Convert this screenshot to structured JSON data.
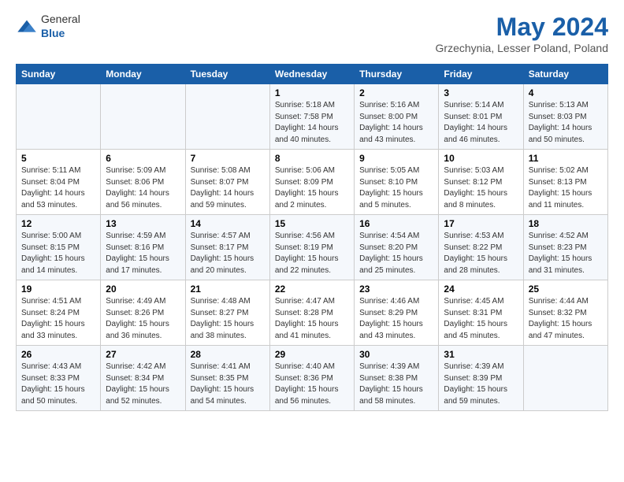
{
  "logo": {
    "text_general": "General",
    "text_blue": "Blue"
  },
  "header": {
    "month": "May 2024",
    "location": "Grzechynia, Lesser Poland, Poland"
  },
  "weekdays": [
    "Sunday",
    "Monday",
    "Tuesday",
    "Wednesday",
    "Thursday",
    "Friday",
    "Saturday"
  ],
  "weeks": [
    [
      {
        "day": "",
        "sunrise": "",
        "sunset": "",
        "daylight": ""
      },
      {
        "day": "",
        "sunrise": "",
        "sunset": "",
        "daylight": ""
      },
      {
        "day": "",
        "sunrise": "",
        "sunset": "",
        "daylight": ""
      },
      {
        "day": "1",
        "sunrise": "Sunrise: 5:18 AM",
        "sunset": "Sunset: 7:58 PM",
        "daylight": "Daylight: 14 hours and 40 minutes."
      },
      {
        "day": "2",
        "sunrise": "Sunrise: 5:16 AM",
        "sunset": "Sunset: 8:00 PM",
        "daylight": "Daylight: 14 hours and 43 minutes."
      },
      {
        "day": "3",
        "sunrise": "Sunrise: 5:14 AM",
        "sunset": "Sunset: 8:01 PM",
        "daylight": "Daylight: 14 hours and 46 minutes."
      },
      {
        "day": "4",
        "sunrise": "Sunrise: 5:13 AM",
        "sunset": "Sunset: 8:03 PM",
        "daylight": "Daylight: 14 hours and 50 minutes."
      }
    ],
    [
      {
        "day": "5",
        "sunrise": "Sunrise: 5:11 AM",
        "sunset": "Sunset: 8:04 PM",
        "daylight": "Daylight: 14 hours and 53 minutes."
      },
      {
        "day": "6",
        "sunrise": "Sunrise: 5:09 AM",
        "sunset": "Sunset: 8:06 PM",
        "daylight": "Daylight: 14 hours and 56 minutes."
      },
      {
        "day": "7",
        "sunrise": "Sunrise: 5:08 AM",
        "sunset": "Sunset: 8:07 PM",
        "daylight": "Daylight: 14 hours and 59 minutes."
      },
      {
        "day": "8",
        "sunrise": "Sunrise: 5:06 AM",
        "sunset": "Sunset: 8:09 PM",
        "daylight": "Daylight: 15 hours and 2 minutes."
      },
      {
        "day": "9",
        "sunrise": "Sunrise: 5:05 AM",
        "sunset": "Sunset: 8:10 PM",
        "daylight": "Daylight: 15 hours and 5 minutes."
      },
      {
        "day": "10",
        "sunrise": "Sunrise: 5:03 AM",
        "sunset": "Sunset: 8:12 PM",
        "daylight": "Daylight: 15 hours and 8 minutes."
      },
      {
        "day": "11",
        "sunrise": "Sunrise: 5:02 AM",
        "sunset": "Sunset: 8:13 PM",
        "daylight": "Daylight: 15 hours and 11 minutes."
      }
    ],
    [
      {
        "day": "12",
        "sunrise": "Sunrise: 5:00 AM",
        "sunset": "Sunset: 8:15 PM",
        "daylight": "Daylight: 15 hours and 14 minutes."
      },
      {
        "day": "13",
        "sunrise": "Sunrise: 4:59 AM",
        "sunset": "Sunset: 8:16 PM",
        "daylight": "Daylight: 15 hours and 17 minutes."
      },
      {
        "day": "14",
        "sunrise": "Sunrise: 4:57 AM",
        "sunset": "Sunset: 8:17 PM",
        "daylight": "Daylight: 15 hours and 20 minutes."
      },
      {
        "day": "15",
        "sunrise": "Sunrise: 4:56 AM",
        "sunset": "Sunset: 8:19 PM",
        "daylight": "Daylight: 15 hours and 22 minutes."
      },
      {
        "day": "16",
        "sunrise": "Sunrise: 4:54 AM",
        "sunset": "Sunset: 8:20 PM",
        "daylight": "Daylight: 15 hours and 25 minutes."
      },
      {
        "day": "17",
        "sunrise": "Sunrise: 4:53 AM",
        "sunset": "Sunset: 8:22 PM",
        "daylight": "Daylight: 15 hours and 28 minutes."
      },
      {
        "day": "18",
        "sunrise": "Sunrise: 4:52 AM",
        "sunset": "Sunset: 8:23 PM",
        "daylight": "Daylight: 15 hours and 31 minutes."
      }
    ],
    [
      {
        "day": "19",
        "sunrise": "Sunrise: 4:51 AM",
        "sunset": "Sunset: 8:24 PM",
        "daylight": "Daylight: 15 hours and 33 minutes."
      },
      {
        "day": "20",
        "sunrise": "Sunrise: 4:49 AM",
        "sunset": "Sunset: 8:26 PM",
        "daylight": "Daylight: 15 hours and 36 minutes."
      },
      {
        "day": "21",
        "sunrise": "Sunrise: 4:48 AM",
        "sunset": "Sunset: 8:27 PM",
        "daylight": "Daylight: 15 hours and 38 minutes."
      },
      {
        "day": "22",
        "sunrise": "Sunrise: 4:47 AM",
        "sunset": "Sunset: 8:28 PM",
        "daylight": "Daylight: 15 hours and 41 minutes."
      },
      {
        "day": "23",
        "sunrise": "Sunrise: 4:46 AM",
        "sunset": "Sunset: 8:29 PM",
        "daylight": "Daylight: 15 hours and 43 minutes."
      },
      {
        "day": "24",
        "sunrise": "Sunrise: 4:45 AM",
        "sunset": "Sunset: 8:31 PM",
        "daylight": "Daylight: 15 hours and 45 minutes."
      },
      {
        "day": "25",
        "sunrise": "Sunrise: 4:44 AM",
        "sunset": "Sunset: 8:32 PM",
        "daylight": "Daylight: 15 hours and 47 minutes."
      }
    ],
    [
      {
        "day": "26",
        "sunrise": "Sunrise: 4:43 AM",
        "sunset": "Sunset: 8:33 PM",
        "daylight": "Daylight: 15 hours and 50 minutes."
      },
      {
        "day": "27",
        "sunrise": "Sunrise: 4:42 AM",
        "sunset": "Sunset: 8:34 PM",
        "daylight": "Daylight: 15 hours and 52 minutes."
      },
      {
        "day": "28",
        "sunrise": "Sunrise: 4:41 AM",
        "sunset": "Sunset: 8:35 PM",
        "daylight": "Daylight: 15 hours and 54 minutes."
      },
      {
        "day": "29",
        "sunrise": "Sunrise: 4:40 AM",
        "sunset": "Sunset: 8:36 PM",
        "daylight": "Daylight: 15 hours and 56 minutes."
      },
      {
        "day": "30",
        "sunrise": "Sunrise: 4:39 AM",
        "sunset": "Sunset: 8:38 PM",
        "daylight": "Daylight: 15 hours and 58 minutes."
      },
      {
        "day": "31",
        "sunrise": "Sunrise: 4:39 AM",
        "sunset": "Sunset: 8:39 PM",
        "daylight": "Daylight: 15 hours and 59 minutes."
      },
      {
        "day": "",
        "sunrise": "",
        "sunset": "",
        "daylight": ""
      }
    ]
  ]
}
